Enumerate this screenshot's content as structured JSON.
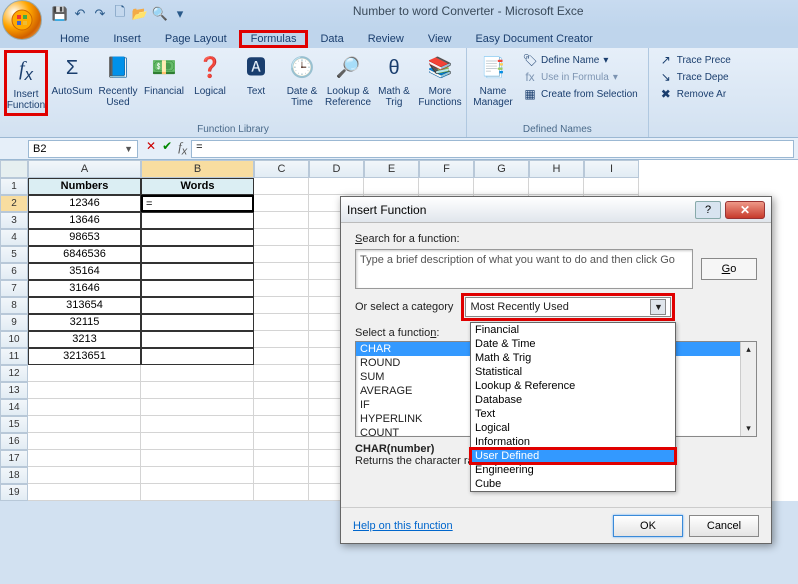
{
  "title": "Number to word Converter - Microsoft Exce",
  "tabs": [
    "Home",
    "Insert",
    "Page Layout",
    "Formulas",
    "Data",
    "Review",
    "View",
    "Easy Document Creator"
  ],
  "active_tab_index": 3,
  "ribbon": {
    "insert_function": "Insert Function",
    "autosum": "AutoSum",
    "recently_used": "Recently Used",
    "financial": "Financial",
    "logical": "Logical",
    "text": "Text",
    "date_time": "Date & Time",
    "lookup_ref": "Lookup & Reference",
    "math_trig": "Math & Trig",
    "more_functions": "More Functions",
    "group_functions": "Function Library",
    "name_manager": "Name Manager",
    "define_name": "Define Name",
    "use_in_formula": "Use in Formula",
    "create_selection": "Create from Selection",
    "group_names": "Defined Names",
    "trace_prec": "Trace Prece",
    "trace_dep": "Trace Depe",
    "remove_ar": "Remove Ar"
  },
  "namebox": "B2",
  "formula": "=",
  "columns": [
    "A",
    "B",
    "C",
    "D",
    "E",
    "F",
    "G",
    "H",
    "I"
  ],
  "rows_shown": 19,
  "headers": {
    "a": "Numbers",
    "b": "Words"
  },
  "cell_data": {
    "A2": "12346",
    "B2": "=",
    "A3": "13646",
    "A4": "98653",
    "A5": "6846536",
    "A6": "35164",
    "A7": "31646",
    "A8": "313654",
    "A9": "32115",
    "A10": "3213",
    "A11": "3213651"
  },
  "dialog": {
    "title": "Insert Function",
    "search_label": "Search for a function:",
    "search_placeholder": "Type a brief description of what you want to do and then click Go",
    "go": "Go",
    "category_label": "Or select a category",
    "category_value": "Most Recently Used",
    "category_options": [
      "Financial",
      "Date & Time",
      "Math & Trig",
      "Statistical",
      "Lookup & Reference",
      "Database",
      "Text",
      "Logical",
      "Information",
      "User Defined",
      "Engineering",
      "Cube"
    ],
    "category_highlight_index": 9,
    "select_label": "Select a function:",
    "functions": [
      "CHAR",
      "ROUND",
      "SUM",
      "AVERAGE",
      "IF",
      "HYPERLINK",
      "COUNT"
    ],
    "function_selected_index": 0,
    "desc_title": "CHAR(number)",
    "desc_body": "Returns the character                                                    racter set for your computer.",
    "help_link": "Help on this function",
    "ok": "OK",
    "cancel": "Cancel"
  }
}
